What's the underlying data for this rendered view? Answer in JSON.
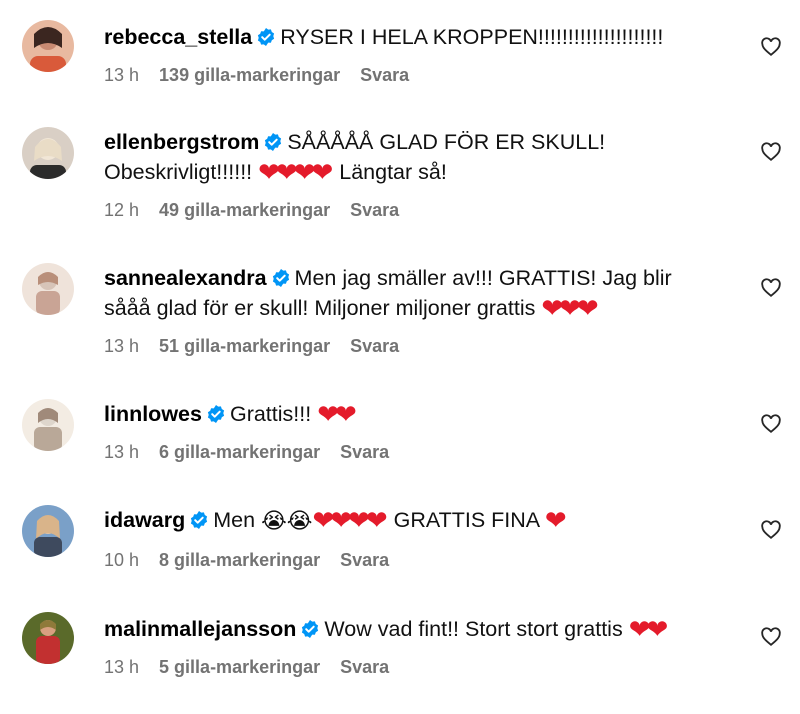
{
  "comments": [
    {
      "username": "rebecca_stella",
      "text_before": "RYSER I HELA KROPPEN!!!!!!!!!!!!!!!!!!!!!",
      "text_line2": "",
      "hearts": "",
      "text_after": "",
      "time": "13 h",
      "likes": "139 gilla-markeringar",
      "reply": "Svara",
      "avatar_colors": [
        "#c98a72",
        "#3b2620",
        "#e8b9a0"
      ]
    },
    {
      "username": "ellenbergstrom",
      "text_before": "SÅÅÅÅÅ GLAD FÖR ER SKULL!",
      "text_line2": "Obeskrivligt!!!!!! ",
      "hearts": "❤❤❤❤",
      "text_after": " Längtar så!",
      "time": "12 h",
      "likes": "49 gilla-markeringar",
      "reply": "Svara",
      "avatar_colors": [
        "#d9cfc5",
        "#f1e6d6",
        "#8b7b6b"
      ]
    },
    {
      "username": "sannealexandra",
      "text_before": "Men jag smäller av!!! GRATTIS! Jag blir",
      "text_line2": "sååå glad för er skull! Miljoner miljoner grattis ",
      "hearts": "❤❤❤",
      "text_after": "",
      "time": "13 h",
      "likes": "51 gilla-markeringar",
      "reply": "Svara",
      "avatar_colors": [
        "#d7c4b8",
        "#b98f7a",
        "#efe3da"
      ]
    },
    {
      "username": "linnlowes",
      "text_before": "Grattis!!! ",
      "hearts": "❤❤",
      "text_line2": "",
      "text_after": "",
      "time": "13 h",
      "likes": "6 gilla-markeringar",
      "reply": "Svara",
      "avatar_colors": [
        "#ded6cc",
        "#a08a7a",
        "#f3ece3"
      ]
    },
    {
      "username": "idawarg",
      "text_before": "Men ",
      "cry": "😭😭",
      "hearts": "❤❤❤❤",
      "text_after": " GRATTIS FINA ",
      "hearts_after": "❤",
      "text_line2": "",
      "time": "10 h",
      "likes": "8 gilla-markeringar",
      "reply": "Svara",
      "avatar_colors": [
        "#7aa0c8",
        "#d9b48a",
        "#3e4a5e"
      ]
    },
    {
      "username": "malinmallejansson",
      "text_before": "Wow vad fint!! Stort stort grattis ",
      "hearts": "❤❤",
      "text_line2": "",
      "text_after": "",
      "time": "13 h",
      "likes": "5 gilla-markeringar",
      "reply": "Svara",
      "avatar_colors": [
        "#8f7a3a",
        "#c23030",
        "#5a6a2a"
      ]
    }
  ],
  "colors": {
    "verified": "#0095f6",
    "meta_text": "#737373",
    "heart_red": "#e41b2b"
  },
  "icons": {
    "verified": "verified-badge-icon",
    "like": "heart-outline-icon"
  }
}
